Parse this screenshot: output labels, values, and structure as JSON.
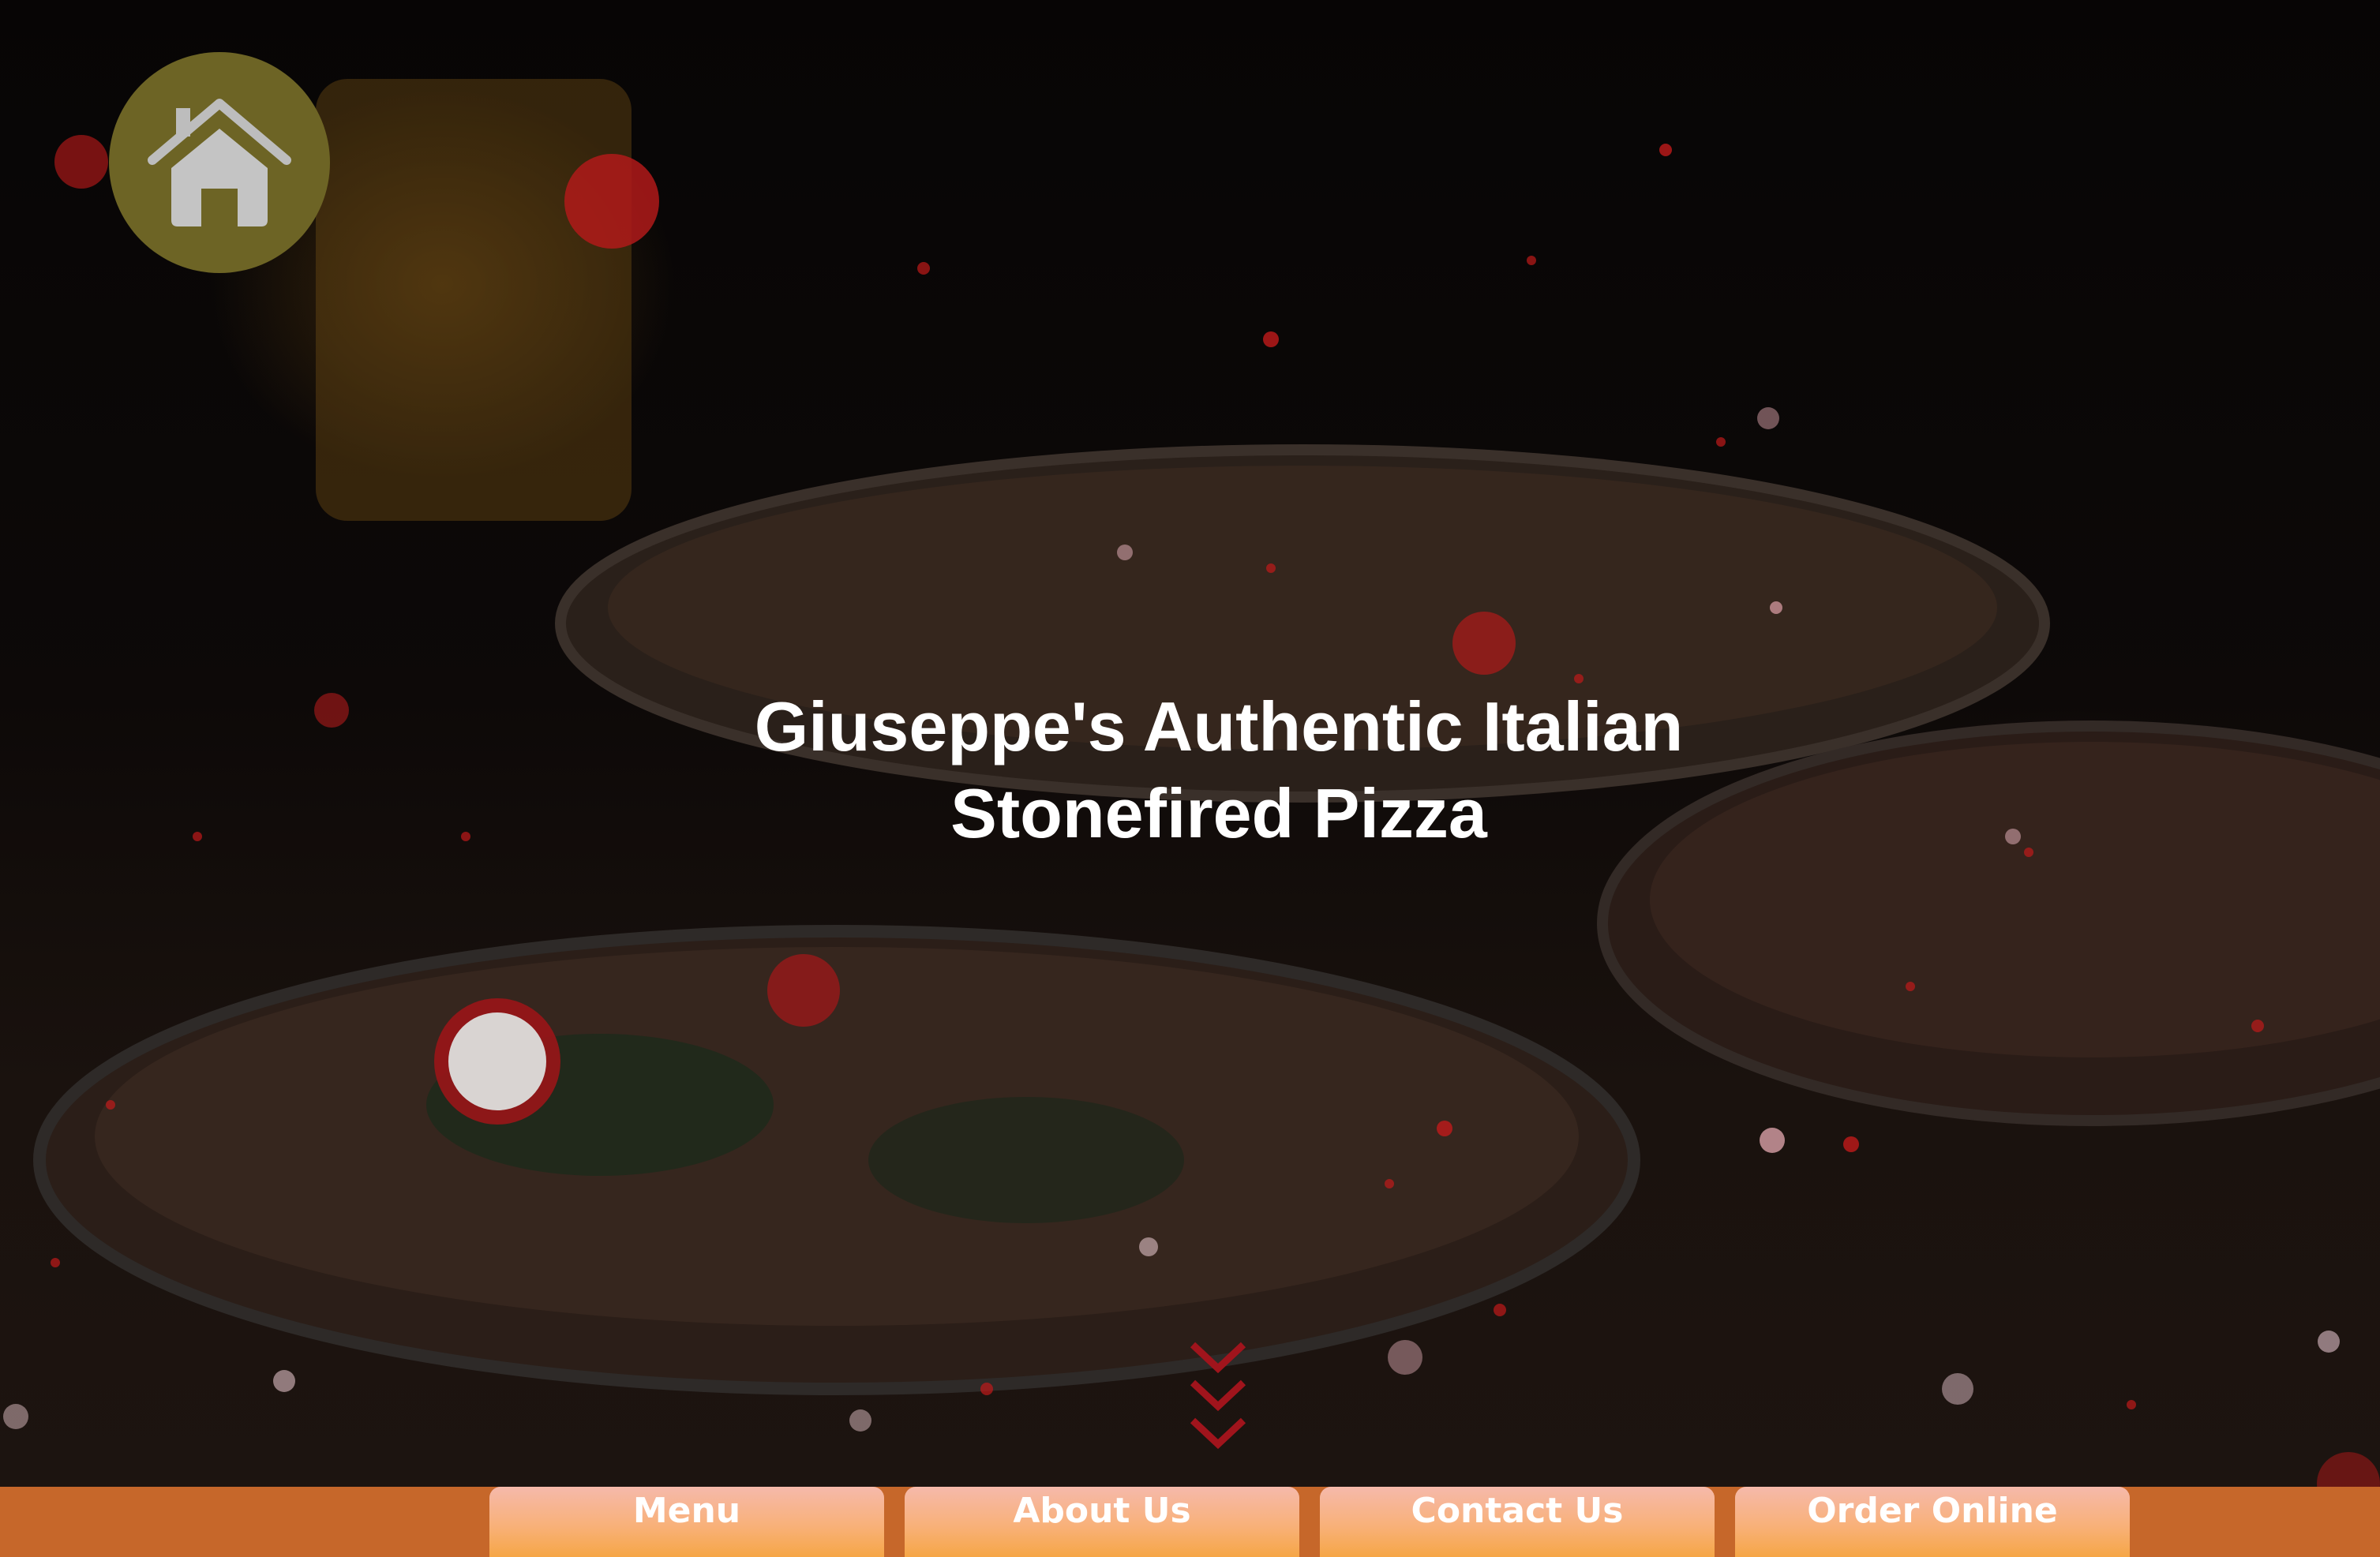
{
  "header": {
    "home_icon": "home-icon"
  },
  "hero": {
    "title_line1": "Giuseppe's Authentic Italian",
    "title_line2": "Stonefired Pizza",
    "scroll_icon": "chevrons-down-icon"
  },
  "nav": {
    "items": [
      {
        "label": "Menu"
      },
      {
        "label": "About Us"
      },
      {
        "label": "Contact Us"
      },
      {
        "label": "Order Online"
      }
    ]
  },
  "colors": {
    "nav_bar": "#c6672a",
    "button_top": "#f6b9ab",
    "button_bottom": "#f6a646",
    "home_circle": "#6d6425",
    "chevron": "#a0141c"
  }
}
